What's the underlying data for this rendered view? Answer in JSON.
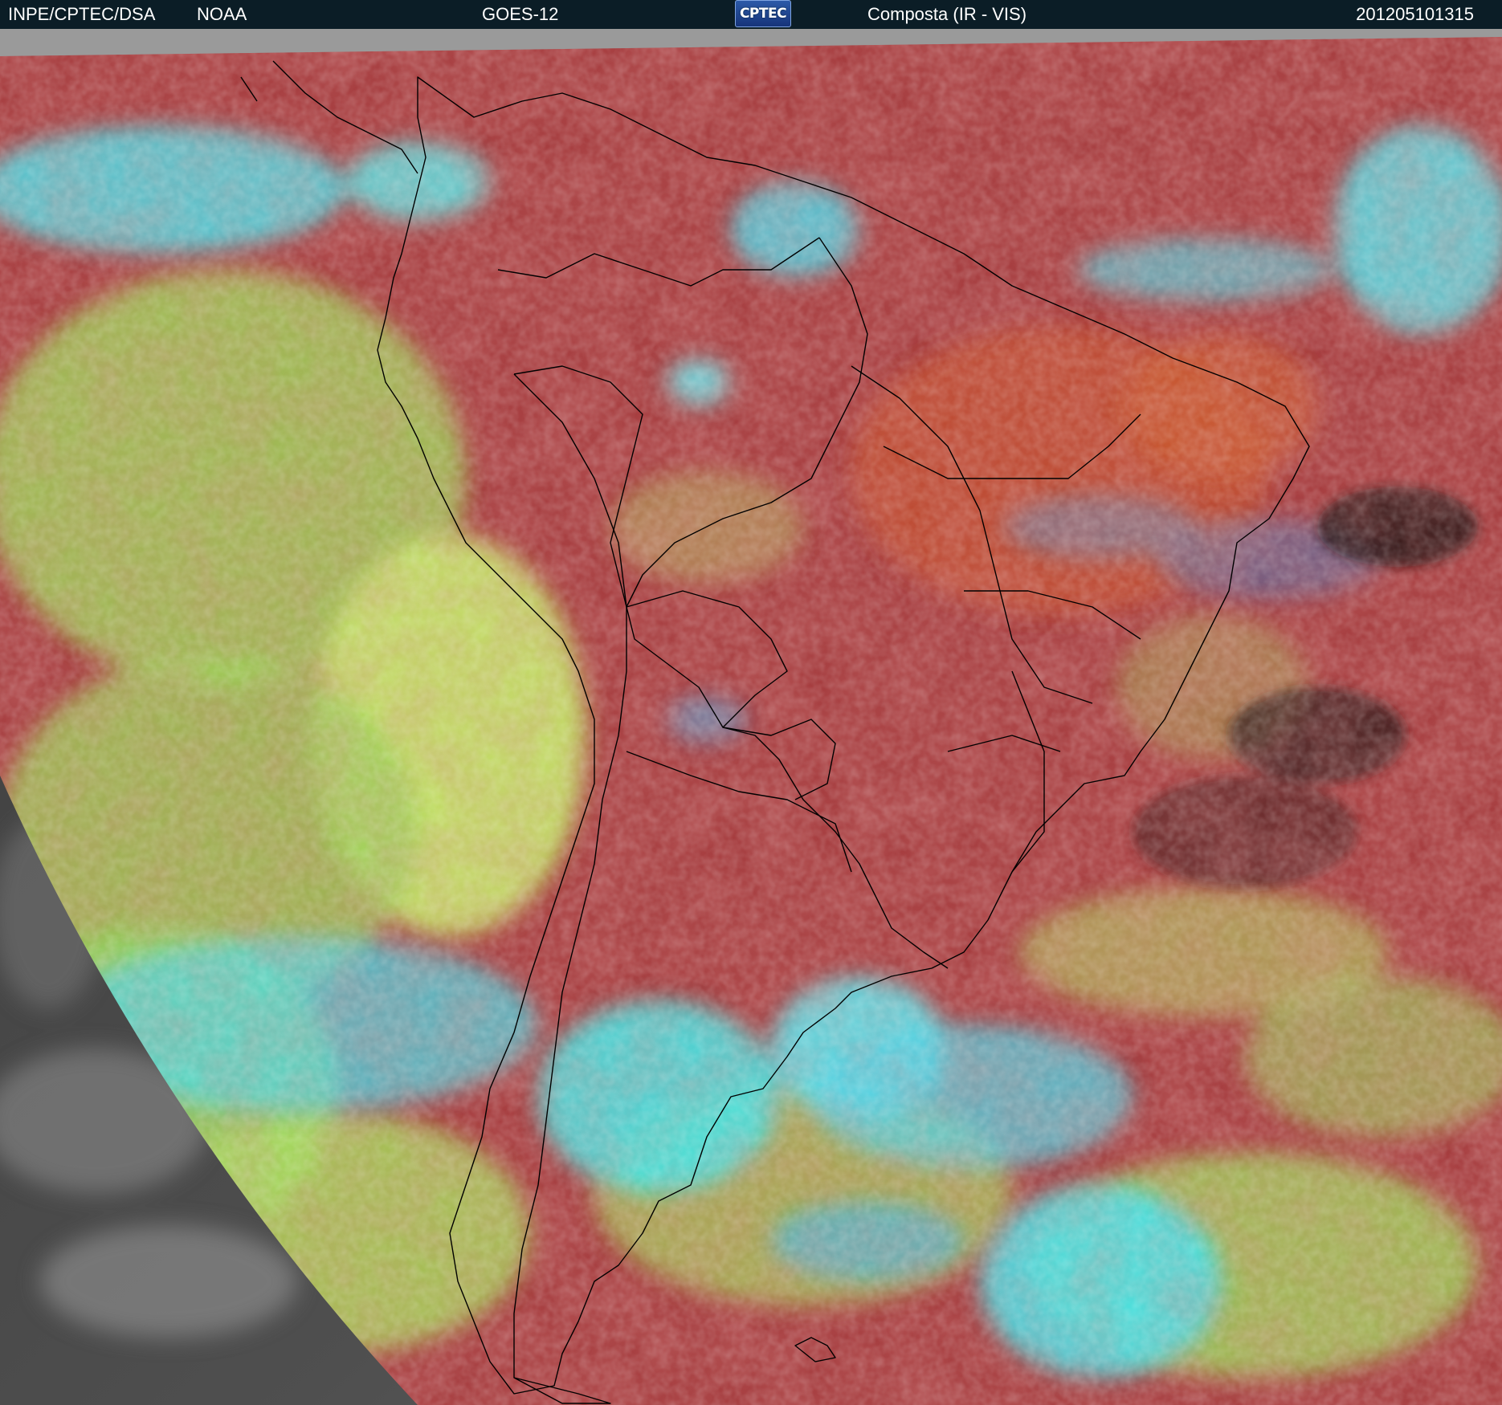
{
  "header": {
    "source": "INPE/CPTEC/DSA",
    "agency": "NOAA",
    "satellite": "GOES-12",
    "logo_text": "CPTEC",
    "product": "Composta (IR - VIS)",
    "timestamp": "201205101315"
  },
  "colors": {
    "header_bg": "#0b1d26",
    "header_text": "#ffffff",
    "clear_land_ocean": "#a83c3c",
    "warm_surface": "#c24a2e",
    "low_cloud": "#a7e05e",
    "high_cloud": "#48e6e6",
    "night_side": "#4a4a4a",
    "no_data_band": "#9a9a9a",
    "borders": "#000000"
  }
}
